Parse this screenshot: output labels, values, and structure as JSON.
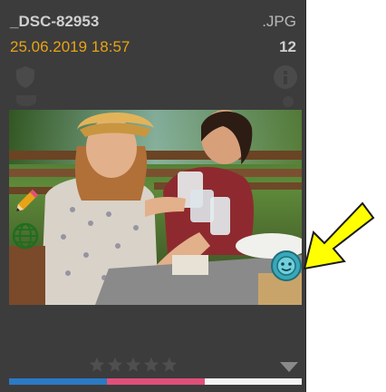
{
  "card": {
    "filename": "_DSC-82953",
    "filetype": ".JPG",
    "datetime": "25.06.2019 18:57",
    "count": "12",
    "rating": 0,
    "max_rating": 5
  },
  "colors": {
    "card_bg": "#3c3c3c",
    "datetime": "#e8a316",
    "label_blue": "#2b7ac4",
    "label_pink": "#e0507a",
    "label_white": "#f4f4f4",
    "annotation_arrow": "#ffff00"
  },
  "icons": [
    "shield-icon",
    "info-icon",
    "pencil-icon",
    "globe-icon",
    "face-recognition-icon",
    "star-icon",
    "dropdown-triangle-icon"
  ]
}
